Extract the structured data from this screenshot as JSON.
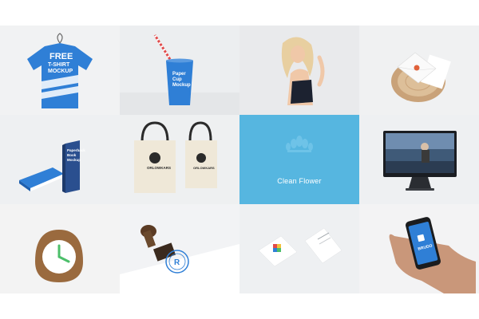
{
  "gallery": {
    "tiles": [
      {
        "name": "tshirt-mockup",
        "text_lines": [
          "FREE",
          "T-SHIRT",
          "MOCKUP"
        ]
      },
      {
        "name": "paper-cup-mockup",
        "text_lines": [
          "Paper",
          "Cup",
          "Mockup"
        ]
      },
      {
        "name": "woman-photo"
      },
      {
        "name": "envelope-mockup"
      },
      {
        "name": "book-mockup",
        "text_lines": [
          "Paperback",
          "Book",
          "Mockup"
        ]
      },
      {
        "name": "tote-bag-mockup",
        "brand": "ORLOWKARS"
      },
      {
        "name": "clean-flower",
        "label": "Clean Flower"
      },
      {
        "name": "imac-mockup"
      },
      {
        "name": "clock-mockup"
      },
      {
        "name": "stamp-mockup"
      },
      {
        "name": "business-card-mockup"
      },
      {
        "name": "iphone-mockup",
        "app_label": "BRUDO"
      }
    ]
  },
  "colors": {
    "accent_blue": "#2f7fd6",
    "flower_tile": "#56b6e0",
    "tile_bg": "#eef0f2"
  }
}
